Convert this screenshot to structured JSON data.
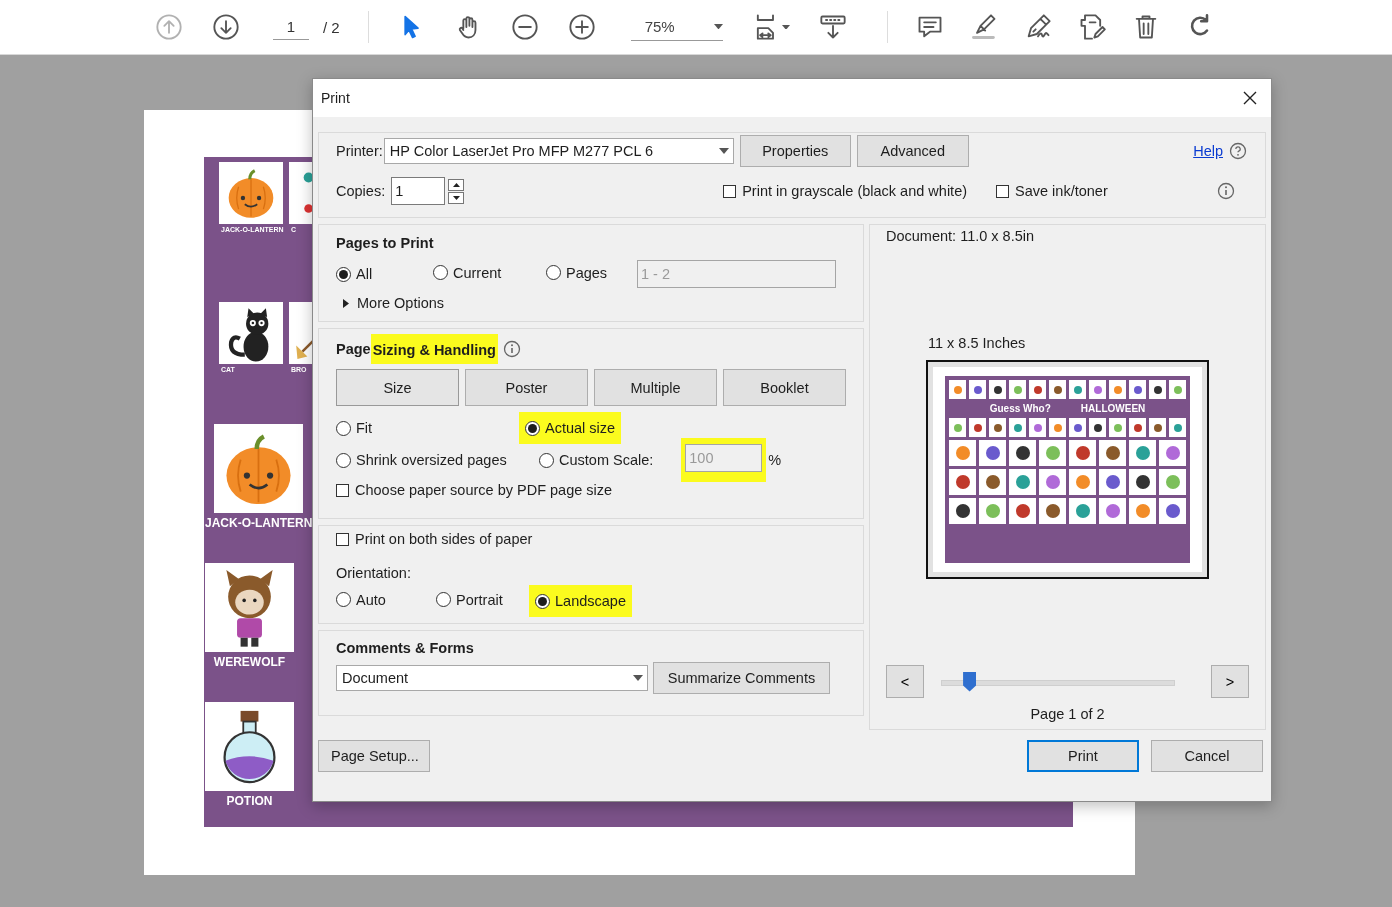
{
  "toolbar": {
    "nav": [
      {
        "disabled": true
      },
      {
        "disabled": false
      }
    ],
    "page_value": "1",
    "page_total": "/ 2",
    "tools": [
      {
        "selected": true
      },
      {
        "selected": false
      }
    ],
    "zoom": "75%"
  },
  "document": {
    "rows": [
      {
        "cards": [
          {
            "label": "JACK-O-LANTERN",
            "kind": "pumpkin"
          },
          {
            "label": "C",
            "kind": "candy"
          }
        ]
      },
      {
        "cards": [
          {
            "label": "CAT",
            "kind": "cat"
          },
          {
            "label": "BRO",
            "kind": "broom"
          }
        ]
      },
      {
        "cards": [
          {
            "label": "JACK-O-LANTERN",
            "kind": "pumpkin"
          }
        ]
      },
      {
        "cards": [
          {
            "label": "WEREWOLF",
            "kind": "werewolf"
          }
        ]
      },
      {
        "cards": [
          {
            "label": "POTION",
            "kind": "potion"
          }
        ]
      }
    ]
  },
  "dialog": {
    "title": "Print",
    "printer": {
      "label": "Printer:",
      "value": "HP Color LaserJet Pro MFP M277 PCL 6"
    },
    "top_buttons": [
      "Properties",
      "Advanced"
    ],
    "help": "Help",
    "copies": {
      "label": "Copies:",
      "value": "1"
    },
    "top_checks": [
      {
        "label": "Print in grayscale (black and white)",
        "checked": false
      },
      {
        "label": "Save ink/toner",
        "checked": false
      }
    ],
    "pages_to_print": {
      "title": "Pages to Print",
      "options": [
        {
          "label": "All",
          "selected": true
        },
        {
          "label": "Current",
          "selected": false
        },
        {
          "label": "Pages",
          "selected": false
        }
      ],
      "range": {
        "value": "1 - 2",
        "disabled": true
      },
      "more_options": {
        "label": "More Options",
        "expanded": false
      }
    },
    "sizing": {
      "title_parts": [
        {
          "text": "Page",
          "highlighted": false
        },
        {
          "text": "Sizing & Handling",
          "highlighted": true
        }
      ],
      "tabs": [
        {
          "label": "Size",
          "selected": true
        },
        {
          "label": "Poster",
          "selected": false
        },
        {
          "label": "Multiple",
          "selected": false
        },
        {
          "label": "Booklet",
          "selected": false
        }
      ],
      "options": [
        {
          "label": "Fit",
          "selected": false,
          "highlighted": false
        },
        {
          "label": "Actual size",
          "selected": true,
          "highlighted": true
        },
        {
          "label": "Shrink oversized pages",
          "selected": false,
          "highlighted": false
        },
        {
          "label": "Custom Scale:",
          "selected": false,
          "highlighted": false
        }
      ],
      "scale": {
        "value": "100",
        "disabled": true,
        "highlighted": true
      },
      "percent": "%",
      "paper_source": {
        "label": "Choose paper source by PDF page size",
        "checked": false
      }
    },
    "duplex": {
      "label": "Print on both sides of paper",
      "checked": false
    },
    "orientation": {
      "label": "Orientation:",
      "options": [
        {
          "label": "Auto",
          "selected": false,
          "highlighted": false
        },
        {
          "label": "Portrait",
          "selected": false,
          "highlighted": false
        },
        {
          "label": "Landscape",
          "selected": true,
          "highlighted": true
        }
      ]
    },
    "comments": {
      "title": "Comments & Forms",
      "value": "Document",
      "button": "Summarize Comments"
    },
    "preview": {
      "document": "Document: 11.0 x 8.5in",
      "size": "11 x 8.5 Inches",
      "sheet_title": "Guess Who?",
      "sheet_subtitle": "HALLOWEEN",
      "prev": "<",
      "next": ">",
      "slider": {
        "level": 0.12
      },
      "page": "Page 1 of 2"
    },
    "bottom": {
      "setup": "Page Setup...",
      "print": "Print",
      "cancel": "Cancel"
    }
  }
}
